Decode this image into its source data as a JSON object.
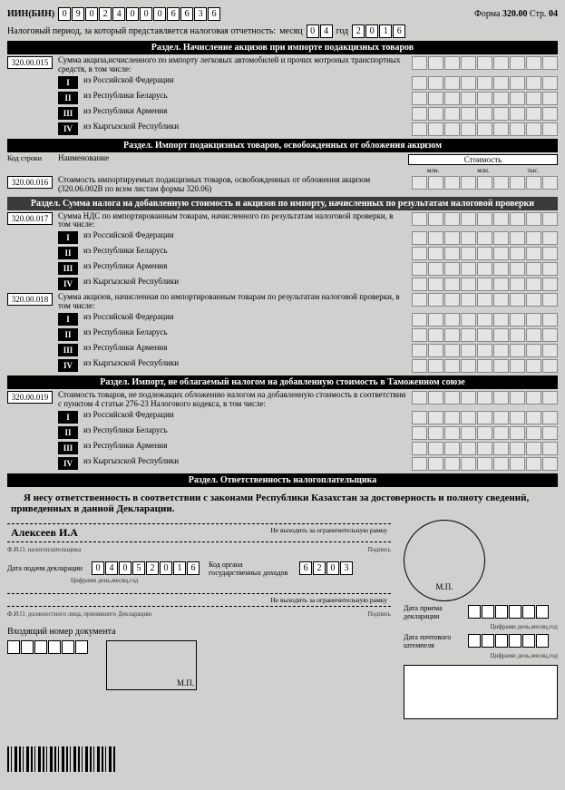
{
  "header": {
    "iin_label": "ИИН(БИН)",
    "iin": [
      "0",
      "9",
      "0",
      "2",
      "4",
      "0",
      "0",
      "0",
      "6",
      "6",
      "3",
      "6"
    ],
    "form_label": "Форма",
    "form_number": "320.00",
    "page_label": "Стр.",
    "page_number": "04",
    "period_text": "Налоговый период, за который представляется налоговая отчетность:",
    "month_label": "месяц",
    "month": [
      "0",
      "4"
    ],
    "year_label": "год",
    "year": [
      "2",
      "0",
      "1",
      "6"
    ]
  },
  "section1": {
    "title": "Раздел. Начисление акцизов при импорте подакцизных товаров",
    "code": "320.00.015",
    "desc": "Сумма акциза,исчисленного по импорту легковых автомобилей и прочих мотроных транспортных средств, в том числе:",
    "rows": [
      {
        "rn": "I",
        "label": "из Российской Федерации"
      },
      {
        "rn": "II",
        "label": "из Республики Беларусь"
      },
      {
        "rn": "III",
        "label": "из Республики Армения"
      },
      {
        "rn": "IV",
        "label": "из Кыргызской Республики"
      }
    ]
  },
  "section2": {
    "title": "Раздел. Импорт подакцизных товаров, освобожденных от обложения акцизом",
    "code_col": "Код строки",
    "name_col": "Наименование",
    "value_col": "Стоимость",
    "units": {
      "a": "млн.",
      "b": "млн.",
      "c": "тыс."
    },
    "code": "320.00.016",
    "desc": "Стоимость импортируемых подакцизных товаров, освобожденных от обложения акцизом (320.06.002В по всем листам формы 320.06)"
  },
  "section3": {
    "title": "Раздел. Сумма налога на добавленную стоимость и акцизов по импорту, начисленных по результатам налоговой проверки",
    "line17": {
      "code": "320.00.017",
      "desc": "Сумма НДС по импортированным товарам, начисленного по результатам налоговой проверки, в том числе:",
      "rows": [
        {
          "rn": "I",
          "label": "из Российской Федерации"
        },
        {
          "rn": "II",
          "label": "из Республики Беларусь"
        },
        {
          "rn": "III",
          "label": "из Республики Армения"
        },
        {
          "rn": "IV",
          "label": "из Кыргызской Республики"
        }
      ]
    },
    "line18": {
      "code": "320.00.018",
      "desc": "Сумма акцизов, начисленная по импортированным товарам по результатам налоговой проверки, в том числе:",
      "rows": [
        {
          "rn": "I",
          "label": "из Российской Федерации"
        },
        {
          "rn": "II",
          "label": "из Республики Беларусь"
        },
        {
          "rn": "III",
          "label": "из Республики Армения"
        },
        {
          "rn": "IV",
          "label": "из Кыргызской Республики"
        }
      ]
    }
  },
  "section4": {
    "title": "Раздел. Импорт, не облагаемый налогом на добавленную стоимость в Таможенном союзе",
    "code": "320.00.019",
    "desc": "Стоимость товаров, не подлежащих обложению налогом на добавленную стоимость в соответствии с пунктом 4 статьи 276-23 Налогового кодекса, в том числе:",
    "rows": [
      {
        "rn": "I",
        "label": "из Российской Федерации"
      },
      {
        "rn": "II",
        "label": "из Республики Беларусь"
      },
      {
        "rn": "III",
        "label": "из Республики Армения"
      },
      {
        "rn": "IV",
        "label": "из Кыргызской Республики"
      }
    ]
  },
  "section5": {
    "title": "Раздел. Ответственность налогоплательщика",
    "statement": "Я несу ответственность в соответствии с законами Республики Казахстан за достоверность и  полноту сведений, приведенных в данной Декларации.",
    "taxpayer_name": "Алексеев И.А",
    "hint_frame": "Не выходить за ограничительную рамку",
    "hint_fio": "Ф.И.О. налогоплательщика",
    "hint_sign": "Подпись",
    "date_label": "Дата подачи декларации",
    "date": [
      "0",
      "4",
      "0",
      "5",
      "2",
      "0",
      "1",
      "6"
    ],
    "date_hint": "Цифрами день,месяц,год",
    "organ_label": "Код органа государственных доходов",
    "organ": [
      "6",
      "2",
      "0",
      "3"
    ],
    "hint_fio2": "Ф.И.О. должностного лица, принявшего Декларацию",
    "incoming_label": "Входящий номер документа",
    "mp": "М.П.",
    "recv_date_label": "Дата приема декларации",
    "post_date_label": "Дата почтового штемпеля",
    "recv_hint": "Цифрами день,месяц,год"
  }
}
